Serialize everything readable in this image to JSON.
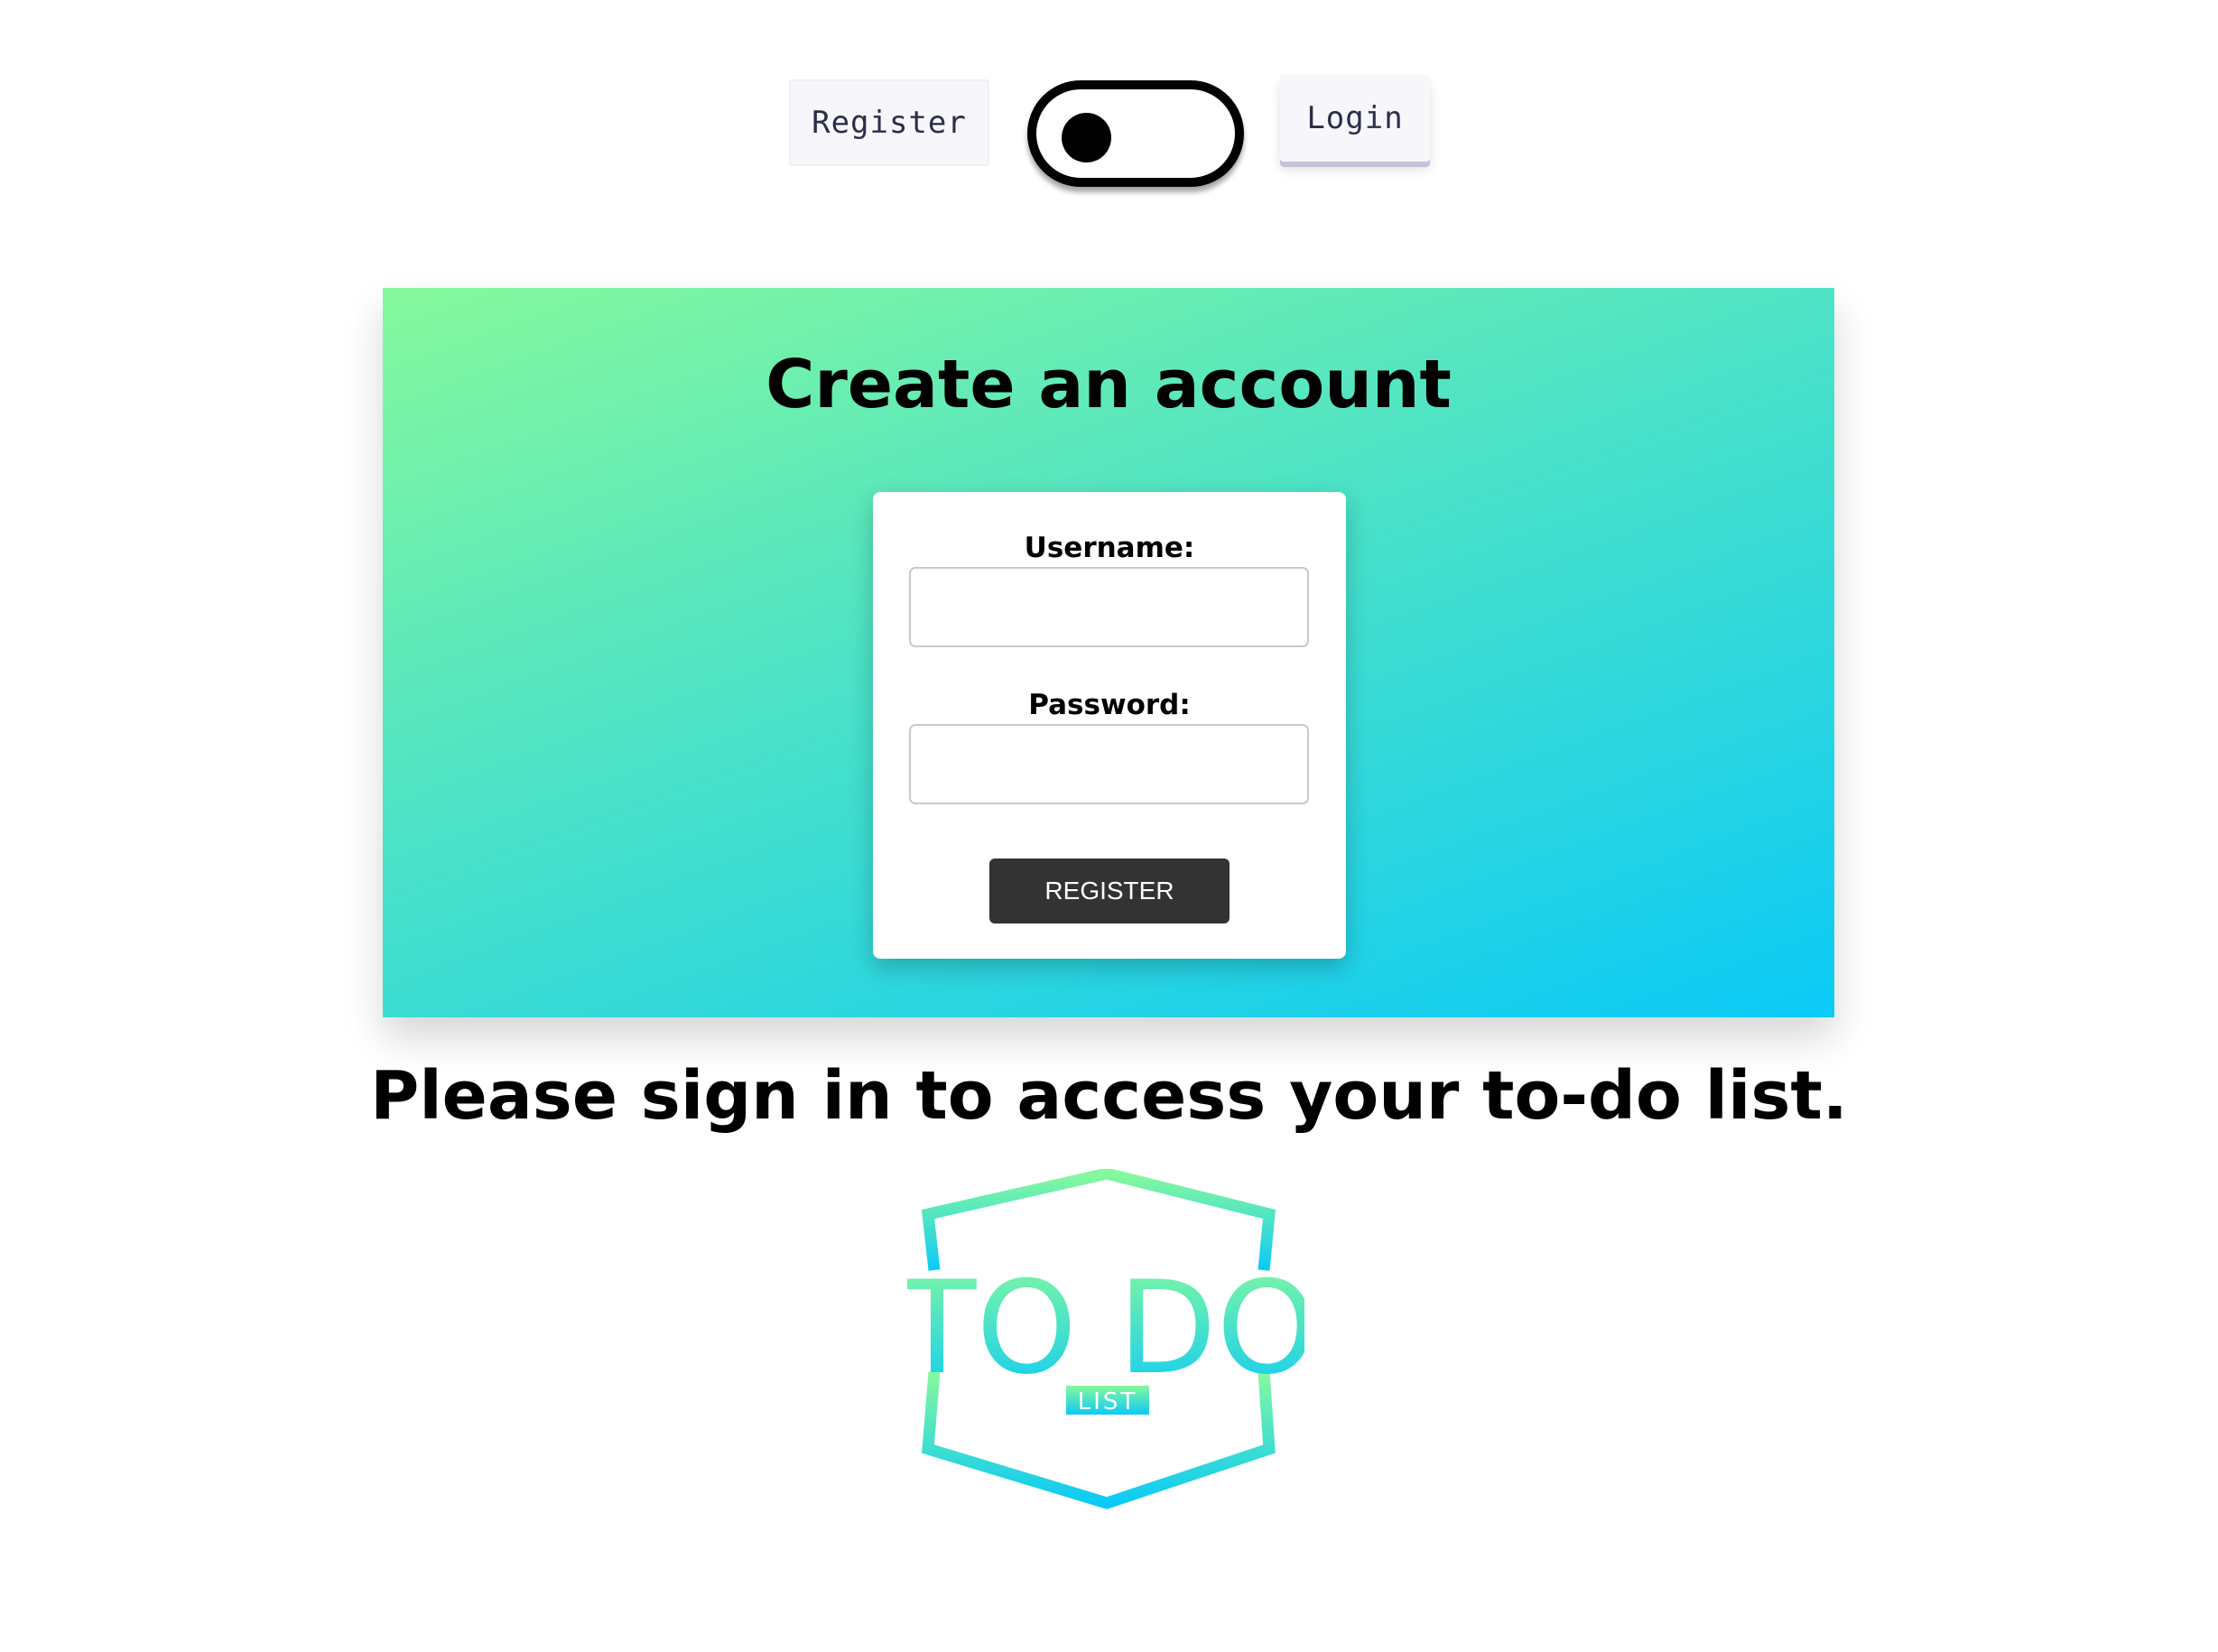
{
  "nav": {
    "register_label": "Register",
    "login_label": "Login",
    "theme_toggle": {
      "state": "off",
      "icon": "toggle-icon"
    }
  },
  "hero": {
    "title": "Create an account",
    "gradient": [
      "#86f99c",
      "#4ee3c5",
      "#0bcaf7"
    ]
  },
  "form": {
    "username_label": "Username:",
    "username_value": "",
    "password_label": "Password:",
    "password_value": "",
    "submit_label": "REGISTER"
  },
  "message": "Please sign in to access your to-do list.",
  "logo": {
    "main_text": "TO DO",
    "sub_text": "LIST",
    "gradient": [
      "#86f99c",
      "#0bcaf7"
    ]
  }
}
